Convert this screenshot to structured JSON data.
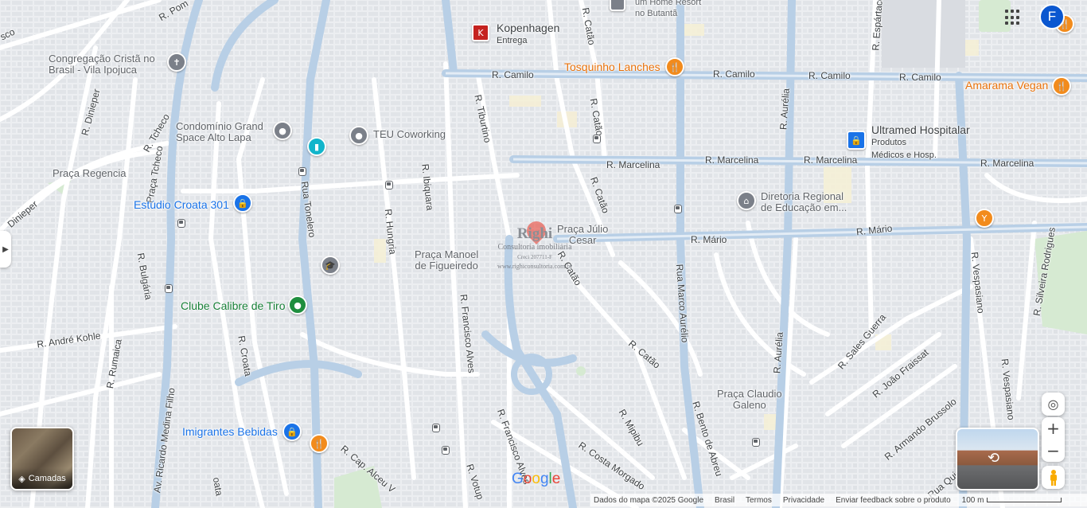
{
  "map": {
    "streets": [
      "R. Pom",
      "sco",
      "R. Dinieper",
      "Dinieper",
      "R. Tcheco",
      "Praça Tcheco",
      "R. Bulgária",
      "R. André Kohle",
      "R. Rumaica",
      "Av. Ricardo Medina Filho",
      "R. Croata",
      "Rua Tonelero",
      "R. Hungria",
      "R. Ibiquara",
      "R. Tiburtino",
      "R. Catão",
      "R. Camilo",
      "R. Camilo",
      "R. Camilo",
      "R. Camilo",
      "R. Marcelina",
      "R. Marcelina",
      "R. Marcelina",
      "R. Marcelina",
      "R. Mário",
      "R. Mário",
      "R. Francisco Alves",
      "R. Francisco Alves",
      "Rua Marco Aurélio",
      "R. Aurélia",
      "R. Aurélia",
      "R. Espártaco",
      "R. Sales Guerra",
      "R. João Fraissat",
      "R. Armando Brussolo",
      "R. Vespasiano",
      "R. Vespasiano",
      "R. Silveira Rodrigues",
      "R. Mipibu",
      "R. Bento de Abreu",
      "R. Costa Morgado",
      "R. Cap. Alceu V",
      "R. Votup",
      "R. Catão",
      "R. Catão",
      "R. Catão",
      "Rua Quirino Do",
      "oata",
      "R. Catão"
    ],
    "places": {
      "kopenhagen": {
        "name": "Kopenhagen",
        "sub": "Entrega"
      },
      "tosquinho": "Tosquinho Lanches",
      "amarama": "Amarama Vegan",
      "home_resort": {
        "name": "um Home Resort",
        "sub": "no Butantã"
      },
      "congregacao": {
        "line1": "Congregação Cristã no",
        "line2": "Brasil - Vila Ipojuca"
      },
      "condominio": {
        "line1": "Condomínio Grand",
        "line2": "Space Alto Lapa"
      },
      "teu": "TEU Coworking",
      "praca_regencia": "Praça Regencia",
      "estudio": "Estúdio Croata 301",
      "clube": "Clube Calibre de Tiro",
      "imigrantes": "Imigrantes Bebidas",
      "praca_manoel": {
        "line1": "Praça Manoel",
        "line2": "de Figueiredo"
      },
      "praca_julio": {
        "line1": "Praça Júlio",
        "line2": "Cesar"
      },
      "ultramed": {
        "name": "Ultramed Hospitalar",
        "sub1": "Produtos",
        "sub2": "Médicos e Hosp."
      },
      "diretoria": {
        "line1": "Diretoria Regional",
        "line2": "de Educação em..."
      },
      "praca_claudio": {
        "line1": "Praça Claudio",
        "line2": "Galeno"
      }
    },
    "watermark": {
      "brand": "Righi",
      "sub": "Consultoria imobiliária",
      "creci": "Creci 207711-F",
      "url": "www.righiconsultoria.com.br"
    }
  },
  "controls": {
    "avatar_letter": "F",
    "layers_label": "Camadas",
    "zoom_in": "+",
    "zoom_out": "−",
    "google_logo": "Google"
  },
  "footer": {
    "data": "Dados do mapa ©2025 Google",
    "country": "Brasil",
    "terms": "Termos",
    "privacy": "Privacidade",
    "feedback": "Enviar feedback sobre o produto",
    "scale": "100 m"
  },
  "colors": {
    "road": "#ffffff",
    "major_road": "#aecbe8",
    "block": "#e4e6ea",
    "accent_blue": "#1a73e8",
    "pin_red": "#ea4335",
    "poi_orange": "#f28b1c",
    "poi_green": "#1e8e3e",
    "poi_gray": "#7b8089"
  }
}
